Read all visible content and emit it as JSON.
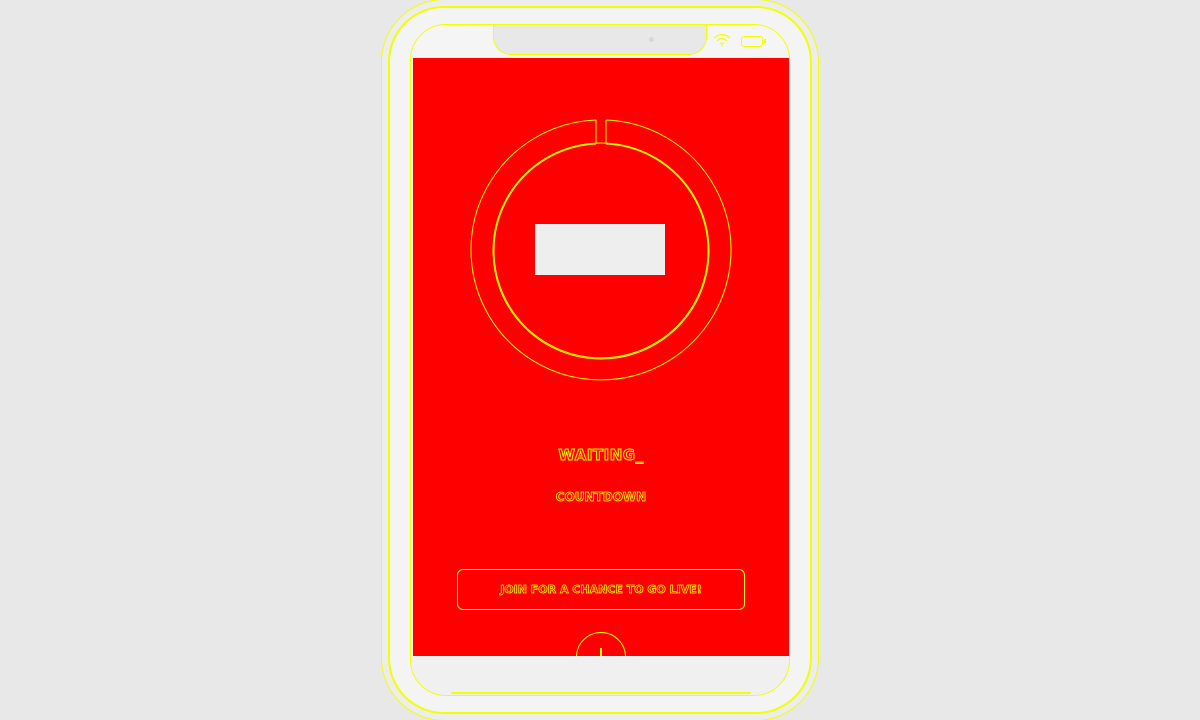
{
  "screen": {
    "status_title": "WAITING_",
    "status_subtitle": "COUNTDOWN",
    "join_button_label": "JOIN FOR A CHANCE TO GO LIVE!"
  },
  "icons": {
    "wifi": "wifi-icon",
    "battery": "battery-icon",
    "add": "plus-icon"
  },
  "colors": {
    "background": "#ff0000",
    "outline": "#f2ff00",
    "frame": "#f4f4f4"
  }
}
